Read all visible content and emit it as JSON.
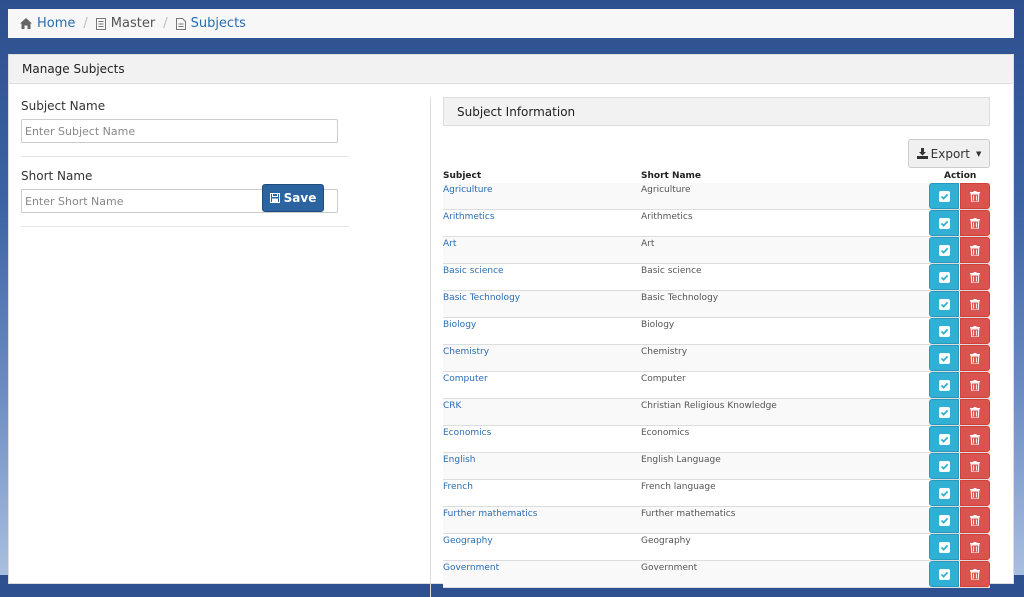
{
  "breadcrumb": {
    "home": "Home",
    "master": "Master",
    "subjects": "Subjects"
  },
  "panel": {
    "title": "Manage Subjects"
  },
  "form": {
    "subject_name_label": "Subject Name",
    "subject_name_placeholder": "Enter Subject Name",
    "short_name_label": "Short Name",
    "short_name_placeholder": "Enter Short Name",
    "save_label": "Save"
  },
  "info": {
    "title": "Subject Information",
    "export_label": "Export",
    "columns": {
      "subject": "Subject",
      "short_name": "Short Name",
      "action": "Action"
    },
    "rows": [
      {
        "subject": "Agriculture",
        "short": "Agriculture"
      },
      {
        "subject": "Arithmetics",
        "short": "Arithmetics"
      },
      {
        "subject": "Art",
        "short": "Art"
      },
      {
        "subject": "Basic science",
        "short": "Basic science"
      },
      {
        "subject": "Basic Technology",
        "short": "Basic Technology"
      },
      {
        "subject": "Biology",
        "short": "Biology"
      },
      {
        "subject": "Chemistry",
        "short": "Chemistry"
      },
      {
        "subject": "Computer",
        "short": "Computer"
      },
      {
        "subject": "CRK",
        "short": "Christian Religious Knowledge"
      },
      {
        "subject": "Economics",
        "short": "Economics"
      },
      {
        "subject": "English",
        "short": "English Language"
      },
      {
        "subject": "French",
        "short": "French language"
      },
      {
        "subject": "Further mathematics",
        "short": "Further mathematics"
      },
      {
        "subject": "Geography",
        "short": "Geography"
      },
      {
        "subject": "Government",
        "short": "Government"
      }
    ]
  },
  "icons": {
    "home": "home-icon",
    "master": "document-icon",
    "subjects": "file-icon",
    "save": "floppy-disk-icon",
    "export": "download-icon",
    "edit": "check-square-icon",
    "delete": "trash-icon"
  },
  "colors": {
    "link": "#2a6db2",
    "save_button": "#2b64a0",
    "edit_button": "#31b0d5",
    "delete_button": "#d9534f"
  }
}
